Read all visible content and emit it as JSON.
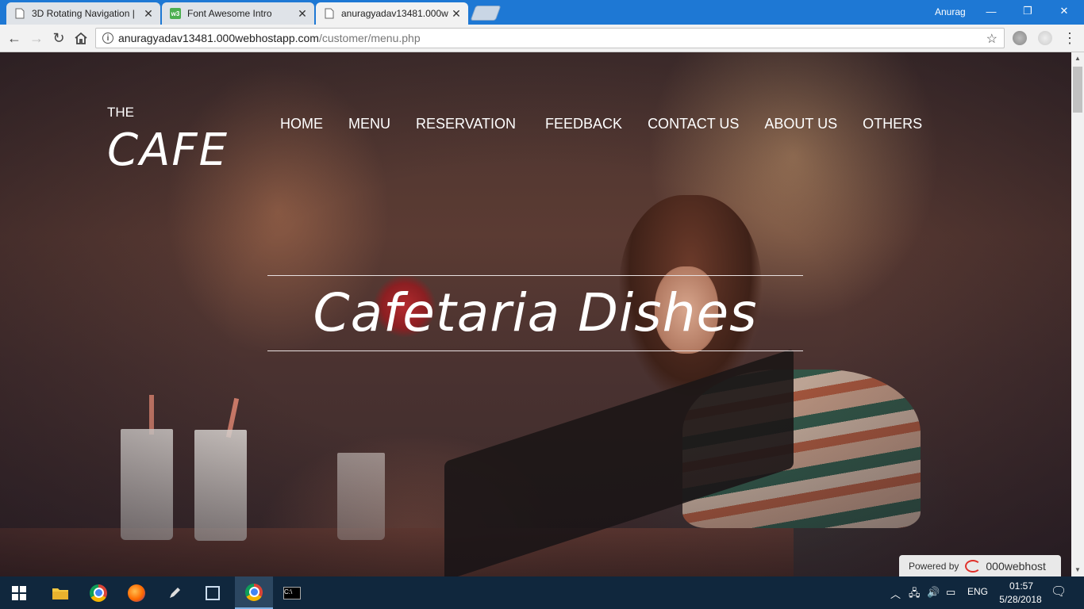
{
  "browser": {
    "tabs": [
      {
        "title": "3D Rotating Navigation |",
        "active": false
      },
      {
        "title": "Font Awesome Intro",
        "active": false
      },
      {
        "title": "anuragyadav13481.000w",
        "active": true
      }
    ],
    "profile_name": "Anurag",
    "url_host": "anuragyadav13481.000webhostapp.com",
    "url_path": "/customer/menu.php"
  },
  "site": {
    "logo_top": "THE",
    "logo_main": "CAFE",
    "nav": [
      "HOME",
      "MENU",
      "RESERVATION",
      "FEEDBACK",
      "CONTACT US",
      "ABOUT US",
      "OTHERS"
    ],
    "hero_title": "Cafetaria Dishes",
    "powered_label": "Powered by",
    "powered_brand": "000webhost"
  },
  "taskbar": {
    "language": "ENG",
    "time": "01:57",
    "date": "5/28/2018"
  },
  "colors": {
    "titlebar": "#1e78d4",
    "taskbar": "#10273d",
    "text_on_hero": "#ffffff"
  }
}
